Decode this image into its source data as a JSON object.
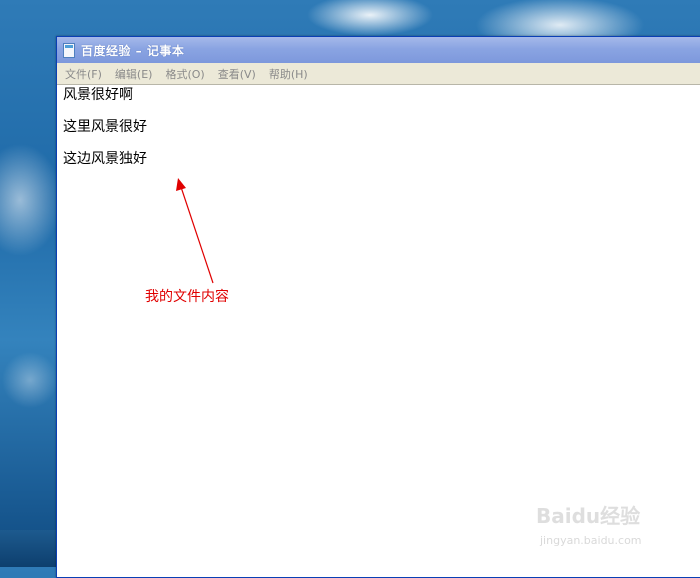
{
  "window": {
    "title": "百度经验 – 记事本"
  },
  "menubar": {
    "items": [
      {
        "label": "文件(F)"
      },
      {
        "label": "编辑(E)"
      },
      {
        "label": "格式(O)"
      },
      {
        "label": "查看(V)"
      },
      {
        "label": "帮助(H)"
      }
    ]
  },
  "editor": {
    "lines": [
      "风景很好啊",
      "这里风景很好",
      "这边风景独好"
    ]
  },
  "annotation": {
    "text": "我的文件内容",
    "color": "#e00000"
  },
  "watermark": {
    "logo": "Baidu经验",
    "url": "jingyan.baidu.com"
  }
}
